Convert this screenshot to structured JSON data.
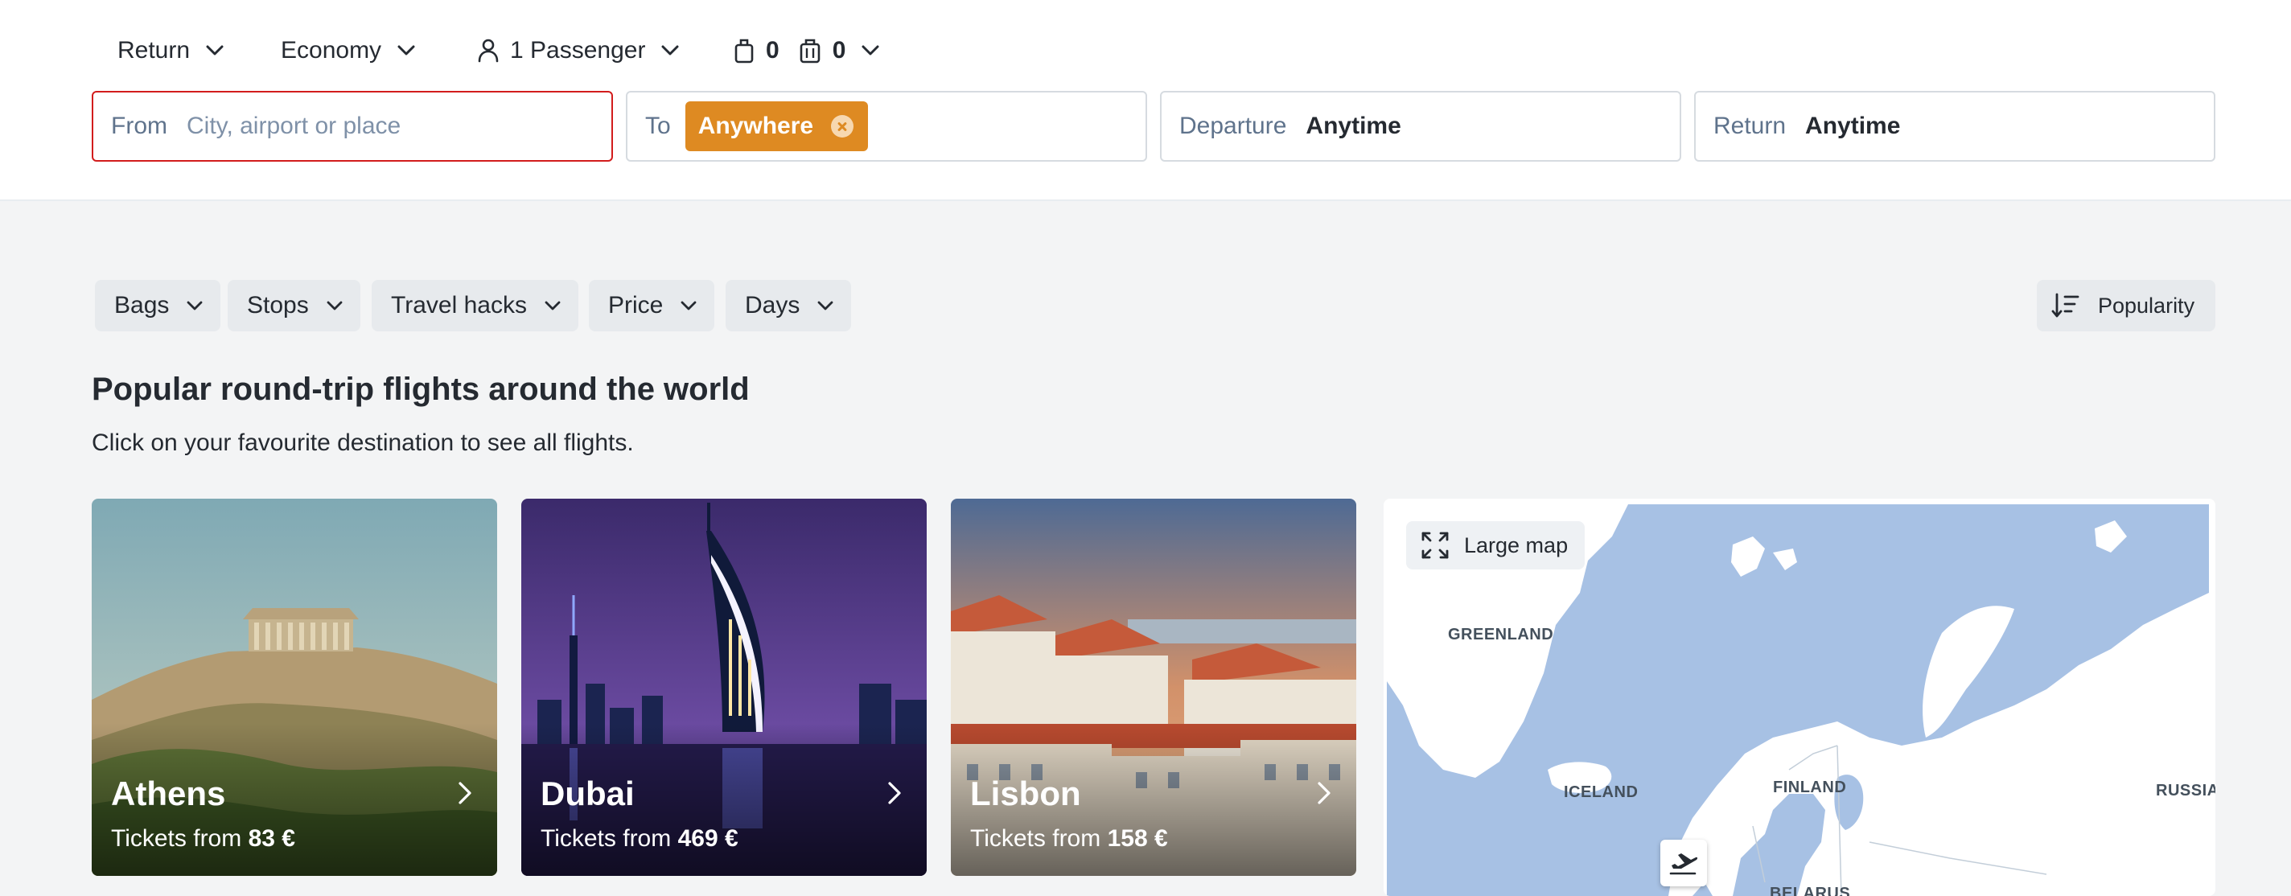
{
  "search_options": {
    "trip_type": "Return",
    "cabin_class": "Economy",
    "passengers": "1 Passenger",
    "cabin_bags": "0",
    "checked_bags": "0"
  },
  "search_fields": {
    "from_label": "From",
    "from_placeholder": "City, airport or place",
    "to_label": "To",
    "to_chip": "Anywhere",
    "departure_label": "Departure",
    "departure_value": "Anytime",
    "return_label": "Return",
    "return_value": "Anytime"
  },
  "filters": {
    "bags": "Bags",
    "stops": "Stops",
    "travel_hacks": "Travel hacks",
    "price": "Price",
    "days": "Days",
    "sort": "Popularity"
  },
  "section": {
    "title": "Popular round-trip flights around the world",
    "subtitle": "Click on your favourite destination to see all flights."
  },
  "destinations": [
    {
      "city": "Athens",
      "price_prefix": "Tickets from",
      "price": "83 €"
    },
    {
      "city": "Dubai",
      "price_prefix": "Tickets from",
      "price": "469 €"
    },
    {
      "city": "Lisbon",
      "price_prefix": "Tickets from",
      "price": "158 €"
    }
  ],
  "map": {
    "large_map_label": "Large map",
    "labels": {
      "greenland": "GREENLAND",
      "iceland": "ICELAND",
      "finland": "FINLAND",
      "russia": "RUSSIA",
      "belarus": "BELARUS"
    }
  },
  "colors": {
    "accent": "#de8a22",
    "focus_border": "#d21c1c",
    "map_water": "#a7c1e4",
    "map_land": "#ffffff"
  }
}
